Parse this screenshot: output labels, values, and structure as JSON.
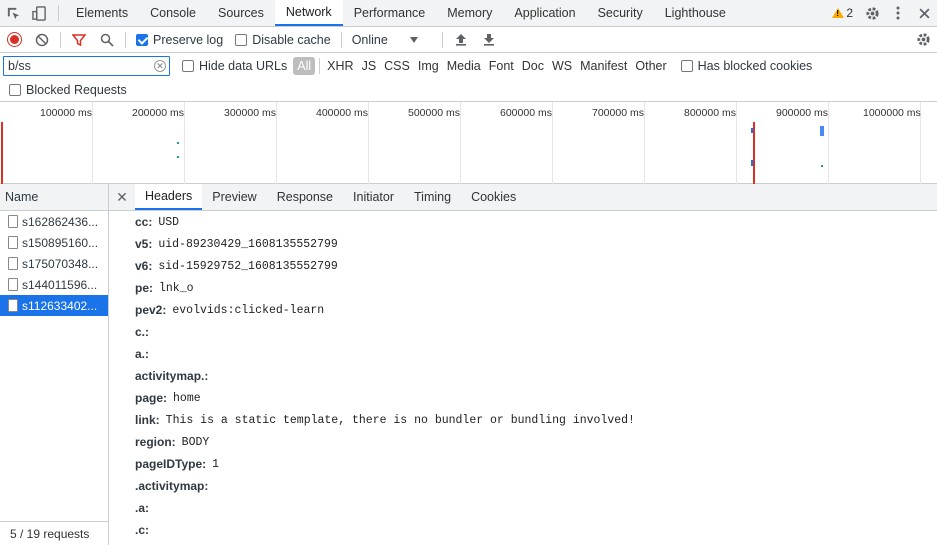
{
  "tabs": [
    "Elements",
    "Console",
    "Sources",
    "Network",
    "Performance",
    "Memory",
    "Application",
    "Security",
    "Lighthouse"
  ],
  "active_tab": "Network",
  "warnings_count": "2",
  "toolbar": {
    "preserve_log": "Preserve log",
    "disable_cache": "Disable cache",
    "throttle": "Online"
  },
  "filter": {
    "value": "b/ss",
    "hide_data_urls": "Hide data URLs",
    "types": [
      "All",
      "XHR",
      "JS",
      "CSS",
      "Img",
      "Media",
      "Font",
      "Doc",
      "WS",
      "Manifest",
      "Other"
    ],
    "has_blocked_cookies": "Has blocked cookies",
    "blocked_requests": "Blocked Requests"
  },
  "timeline": {
    "labels": [
      "100000 ms",
      "200000 ms",
      "300000 ms",
      "400000 ms",
      "500000 ms",
      "600000 ms",
      "700000 ms",
      "800000 ms",
      "900000 ms",
      "1000000 ms"
    ]
  },
  "requests": {
    "header": "Name",
    "items": [
      "s162862436...",
      "s150895160...",
      "s175070348...",
      "s144011596...",
      "s112633402..."
    ],
    "selected_index": 4,
    "footer": "5 / 19 requests"
  },
  "details": {
    "tabs": [
      "Headers",
      "Preview",
      "Response",
      "Initiator",
      "Timing",
      "Cookies"
    ],
    "active": "Headers",
    "params": [
      {
        "k": "cc:",
        "v": "USD"
      },
      {
        "k": "v5:",
        "v": "uid-89230429_1608135552799"
      },
      {
        "k": "v6:",
        "v": "sid-15929752_1608135552799"
      },
      {
        "k": "pe:",
        "v": "lnk_o"
      },
      {
        "k": "pev2:",
        "v": "evolvids:clicked-learn"
      },
      {
        "k": "c.:",
        "v": ""
      },
      {
        "k": "a.:",
        "v": ""
      },
      {
        "k": "activitymap.:",
        "v": ""
      },
      {
        "k": "page:",
        "v": "home"
      },
      {
        "k": "link:",
        "v": "This is a static template, there is no bundler or bundling involved!"
      },
      {
        "k": "region:",
        "v": "BODY"
      },
      {
        "k": "pageIDType:",
        "v": "1"
      },
      {
        "k": ".activitymap:",
        "v": ""
      },
      {
        "k": ".a:",
        "v": ""
      },
      {
        "k": ".c:",
        "v": ""
      }
    ]
  },
  "colors": {
    "accent": "#1a73e8",
    "record": "#d93025",
    "warning": "#f9ab00"
  }
}
